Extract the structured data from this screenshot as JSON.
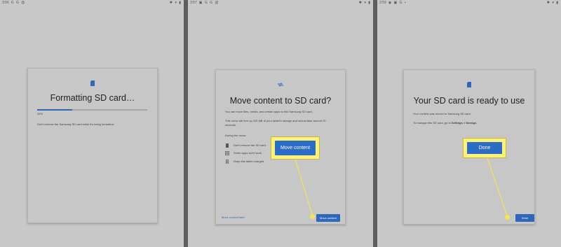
{
  "colors": {
    "accent": "#2f67b9",
    "highlight": "#fbf277",
    "background": "#c8c8c8",
    "divider": "#5e5e5e"
  },
  "panels": [
    {
      "status_bar": {
        "time": "3:56",
        "icons": [
          "google-g-icon",
          "google-g-icon",
          "at-icon"
        ],
        "system_icons": [
          "bluetooth-icon",
          "wifi-icon",
          "battery-icon"
        ]
      },
      "dialog": {
        "icon": "sd-card-icon",
        "title": "Formatting SD card…",
        "progress_percent": 32,
        "progress_label": "32%",
        "message": "Don't remove the Samsung SD card while it's being formatted."
      }
    },
    {
      "status_bar": {
        "time": "3:57",
        "icons": [
          "image-icon",
          "google-g-icon",
          "google-g-icon",
          "at-icon"
        ],
        "system_icons": [
          "bluetooth-icon",
          "wifi-icon",
          "battery-icon"
        ]
      },
      "dialog": {
        "icon": "move-arrows-icon",
        "title": "Move content to SD card?",
        "paragraph1": "You can move files, media, and certain apps to this Samsung SD card.",
        "paragraph2": "This move will free up 410 MB of your tablet's storage and should take around 20 seconds.",
        "during_heading": "During the move:",
        "during_items": [
          {
            "icon": "sd-card-icon",
            "label": "Don't remove the SD card"
          },
          {
            "icon": "apps-grid-icon",
            "label": "Some apps won't work"
          },
          {
            "icon": "battery-charging-icon",
            "label": "Keep this tablet charged"
          }
        ],
        "later_link": "Move content later",
        "primary_button": "Move content",
        "callout_button": "Move content"
      }
    },
    {
      "status_bar": {
        "time": "3:59",
        "icons": [
          "eye-icon",
          "image-icon",
          "google-g-icon",
          "dot-icon"
        ],
        "system_icons": [
          "bluetooth-icon",
          "wifi-icon",
          "battery-icon"
        ]
      },
      "dialog": {
        "icon": "sd-card-icon",
        "title": "Your SD card is ready to use",
        "paragraph1": "Your content was moved to Samsung SD card.",
        "paragraph2_prefix": "To manage this SD card, go to ",
        "paragraph2_bold": "Settings > Storage.",
        "primary_button": "Done",
        "callout_button": "Done"
      }
    }
  ]
}
